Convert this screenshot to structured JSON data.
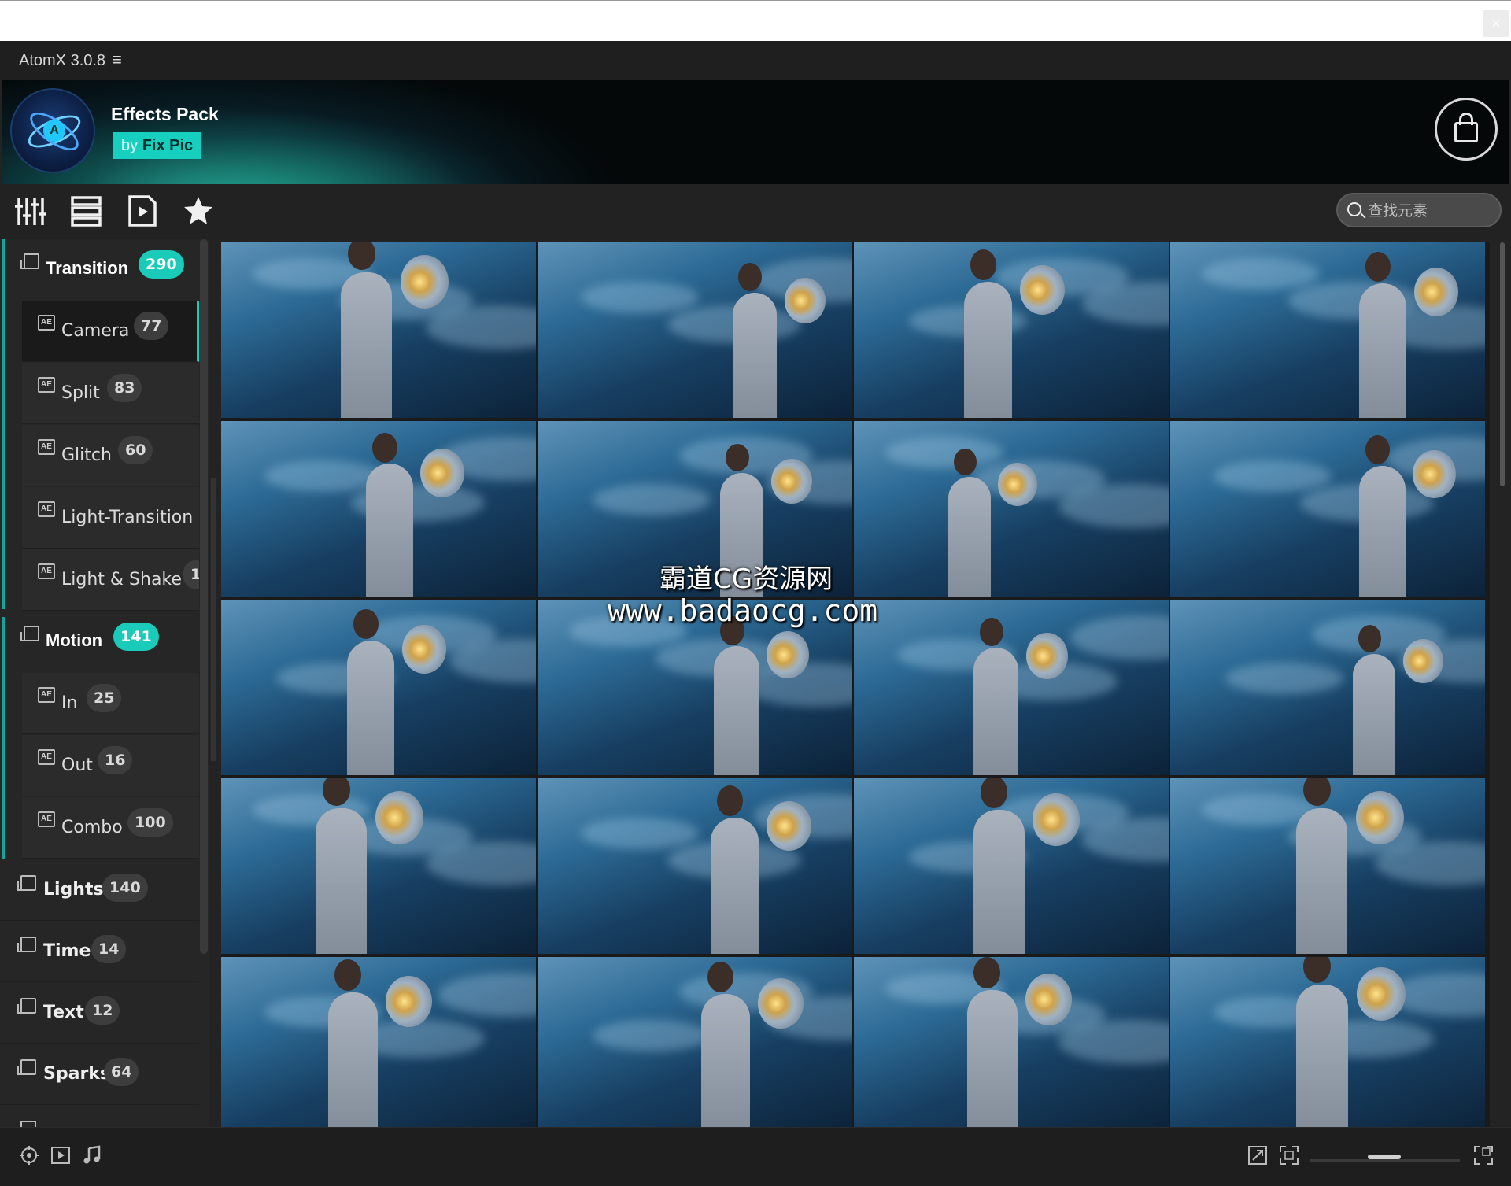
{
  "window": {
    "close_glyph": "×"
  },
  "app": {
    "title": "AtomX 3.0.8",
    "menu_glyph": "≡"
  },
  "banner": {
    "pack_name": "Effects Pack",
    "by_prefix": "by ",
    "author": "Fix Pic",
    "accent": "#19cbb8"
  },
  "toolbar": {
    "icons": [
      "sliders-icon",
      "list-view-icon",
      "video-file-icon",
      "star-icon"
    ],
    "search_placeholder": "查找元素"
  },
  "sidebar": {
    "groups": [
      {
        "label": "Transition",
        "count": "290",
        "children": [
          {
            "label": "Camera",
            "count": "77",
            "active": true
          },
          {
            "label": "Split",
            "count": "83"
          },
          {
            "label": "Glitch",
            "count": "60"
          },
          {
            "label": "Light-Transition",
            "count": ""
          },
          {
            "label": "Light & Shake",
            "count": "1"
          }
        ]
      },
      {
        "label": "Motion",
        "count": "141",
        "children": [
          {
            "label": "In",
            "count": "25"
          },
          {
            "label": "Out",
            "count": "16"
          },
          {
            "label": "Combo",
            "count": "100"
          }
        ]
      }
    ],
    "sections": [
      {
        "label": "Lights",
        "count": "140"
      },
      {
        "label": "Time",
        "count": "14"
      },
      {
        "label": "Text",
        "count": "12"
      },
      {
        "label": "Sparks",
        "count": "64"
      }
    ]
  },
  "watermark": {
    "line1": "霸道CG资源网",
    "line2": "www.badaocg.com"
  },
  "statusbar": {
    "icons": [
      "target-icon",
      "play-box-icon",
      "music-note-icon",
      "expand-icon",
      "fit-icon",
      "fullscreen-icon"
    ]
  }
}
